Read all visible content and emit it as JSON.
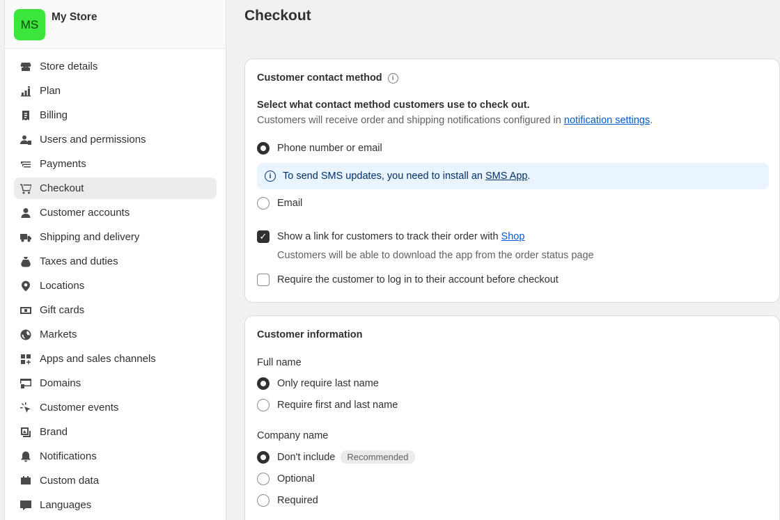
{
  "store": {
    "avatar_initials": "MS",
    "name": "My Store",
    "subtitle": "."
  },
  "sidebar": {
    "items": [
      {
        "label": "Store details",
        "icon": "store-icon"
      },
      {
        "label": "Plan",
        "icon": "plan-icon"
      },
      {
        "label": "Billing",
        "icon": "billing-icon"
      },
      {
        "label": "Users and permissions",
        "icon": "users-icon"
      },
      {
        "label": "Payments",
        "icon": "payments-icon"
      },
      {
        "label": "Checkout",
        "icon": "cart-icon",
        "active": true
      },
      {
        "label": "Customer accounts",
        "icon": "person-icon"
      },
      {
        "label": "Shipping and delivery",
        "icon": "truck-icon"
      },
      {
        "label": "Taxes and duties",
        "icon": "tax-icon"
      },
      {
        "label": "Locations",
        "icon": "location-icon"
      },
      {
        "label": "Gift cards",
        "icon": "gift-card-icon"
      },
      {
        "label": "Markets",
        "icon": "globe-icon"
      },
      {
        "label": "Apps and sales channels",
        "icon": "apps-icon"
      },
      {
        "label": "Domains",
        "icon": "domains-icon"
      },
      {
        "label": "Customer events",
        "icon": "cursor-icon"
      },
      {
        "label": "Brand",
        "icon": "brand-icon"
      },
      {
        "label": "Notifications",
        "icon": "bell-icon"
      },
      {
        "label": "Custom data",
        "icon": "custom-data-icon"
      },
      {
        "label": "Languages",
        "icon": "languages-icon"
      }
    ]
  },
  "page": {
    "title": "Checkout"
  },
  "contact_method": {
    "title": "Customer contact method",
    "prompt": "Select what contact method customers use to check out.",
    "description_prefix": "Customers will receive order and shipping notifications configured in ",
    "description_link": "notification settings",
    "description_suffix": ".",
    "options": [
      {
        "label": "Phone number or email",
        "selected": true
      },
      {
        "label": "Email",
        "selected": false
      }
    ],
    "banner_prefix": "To send SMS updates, you need to install an ",
    "banner_link": "SMS App",
    "banner_suffix": ".",
    "track_label_prefix": "Show a link for customers to track their order with ",
    "track_label_link": "Shop",
    "track_checked": true,
    "track_help": "Customers will be able to download the app from the order status page",
    "require_login_label": "Require the customer to log in to their account before checkout",
    "require_login_checked": false
  },
  "customer_info": {
    "title": "Customer information",
    "full_name": {
      "label": "Full name",
      "options": [
        {
          "label": "Only require last name",
          "selected": true
        },
        {
          "label": "Require first and last name",
          "selected": false
        }
      ]
    },
    "company_name": {
      "label": "Company name",
      "options": [
        {
          "label": "Don't include",
          "selected": true,
          "badge": "Recommended"
        },
        {
          "label": "Optional",
          "selected": false
        },
        {
          "label": "Required",
          "selected": false
        }
      ]
    }
  },
  "colors": {
    "avatar_bg": "#3be53b",
    "link": "#005bd3",
    "banner_bg": "#eaf4ff"
  }
}
